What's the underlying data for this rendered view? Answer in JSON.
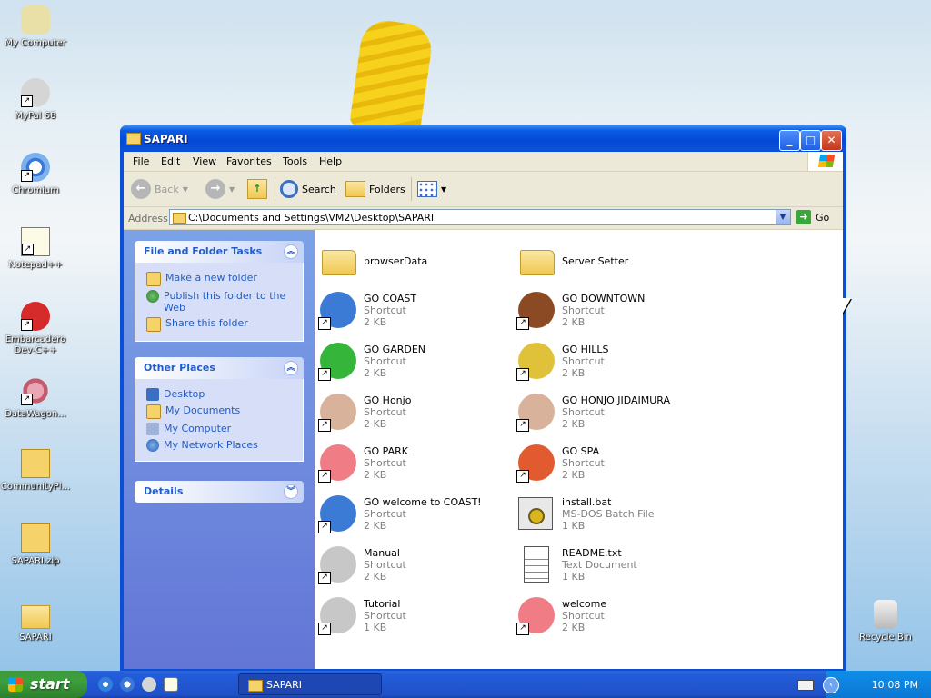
{
  "desktop": {
    "icons": [
      {
        "label": "My Computer",
        "icon": "my-computer-icon"
      },
      {
        "label": "MyPal 68",
        "icon": "raccoon-icon"
      },
      {
        "label": "Chromium",
        "icon": "chromium-icon"
      },
      {
        "label": "Notepad++",
        "icon": "notepad-plus-icon"
      },
      {
        "label": "Embarcadero Dev-C++",
        "icon": "devcpp-icon"
      },
      {
        "label": "DataWagon...",
        "icon": "datawagon-icon"
      },
      {
        "label": "CommunityPl...",
        "icon": "zip-folder-icon"
      },
      {
        "label": "SAPARI.zip",
        "icon": "zip-folder-icon"
      },
      {
        "label": "SAPARI",
        "icon": "folder-icon"
      },
      {
        "label": "Recycle Bin",
        "icon": "recycle-bin-icon"
      }
    ]
  },
  "window": {
    "title": "SAPARI",
    "menu": [
      "File",
      "Edit",
      "View",
      "Favorites",
      "Tools",
      "Help"
    ],
    "toolbar": {
      "back": "Back",
      "search": "Search",
      "folders": "Folders"
    },
    "address": {
      "label": "Address",
      "value": "C:\\Documents and Settings\\VM2\\Desktop\\SAPARI",
      "go": "Go"
    },
    "sidebar": {
      "file_tasks": {
        "title": "File and Folder Tasks",
        "items": [
          "Make a new folder",
          "Publish this folder to the Web",
          "Share this folder"
        ]
      },
      "other_places": {
        "title": "Other Places",
        "items": [
          "Desktop",
          "My Documents",
          "My Computer",
          "My Network Places"
        ]
      },
      "details": {
        "title": "Details"
      }
    },
    "files": [
      {
        "name": "browserData",
        "type": "",
        "size": "",
        "icon": "folder-icon"
      },
      {
        "name": "Server Setter",
        "type": "",
        "size": "",
        "icon": "folder-icon"
      },
      {
        "name": "GO COAST",
        "type": "Shortcut",
        "size": "2 KB",
        "icon": "blue-whale-icon",
        "color": "#3b7bd6"
      },
      {
        "name": "GO DOWNTOWN",
        "type": "Shortcut",
        "size": "2 KB",
        "icon": "owl-icon",
        "color": "#8b4a24"
      },
      {
        "name": "GO GARDEN",
        "type": "Shortcut",
        "size": "2 KB",
        "icon": "frog-icon",
        "color": "#35b53a"
      },
      {
        "name": "GO HILLS",
        "type": "Shortcut",
        "size": "2 KB",
        "icon": "boy-icon",
        "color": "#e0c23a"
      },
      {
        "name": "GO Honjo",
        "type": "Shortcut",
        "size": "2 KB",
        "icon": "old-man-icon",
        "color": "#d8b29b"
      },
      {
        "name": "GO HONJO JIDAIMURA",
        "type": "Shortcut",
        "size": "2 KB",
        "icon": "old-man-icon",
        "color": "#d8b29b"
      },
      {
        "name": "GO PARK",
        "type": "Shortcut",
        "size": "2 KB",
        "icon": "pink-cat-icon",
        "color": "#f07d86"
      },
      {
        "name": "GO SPA",
        "type": "Shortcut",
        "size": "2 KB",
        "icon": "monkey-icon",
        "color": "#e25a30"
      },
      {
        "name": "GO welcome to COAST!",
        "type": "Shortcut",
        "size": "2 KB",
        "icon": "blue-whale-icon",
        "color": "#3b7bd6"
      },
      {
        "name": "install.bat",
        "type": "MS-DOS Batch File",
        "size": "1 KB",
        "icon": "batch-file-icon",
        "color": "#d9d9d9"
      },
      {
        "name": "Manual",
        "type": "Shortcut",
        "size": "2 KB",
        "icon": "raccoon-icon",
        "color": "#c7c7c7"
      },
      {
        "name": "README.txt",
        "type": "Text Document",
        "size": "1 KB",
        "icon": "text-document-icon",
        "color": "#ffffff"
      },
      {
        "name": "Tutorial",
        "type": "Shortcut",
        "size": "1 KB",
        "icon": "raccoon-icon",
        "color": "#c7c7c7"
      },
      {
        "name": "welcome",
        "type": "Shortcut",
        "size": "2 KB",
        "icon": "pink-cat-icon",
        "color": "#f07d86"
      }
    ]
  },
  "taskbar": {
    "start": "start",
    "task": "SAPARI",
    "clock": "10:08 PM"
  }
}
